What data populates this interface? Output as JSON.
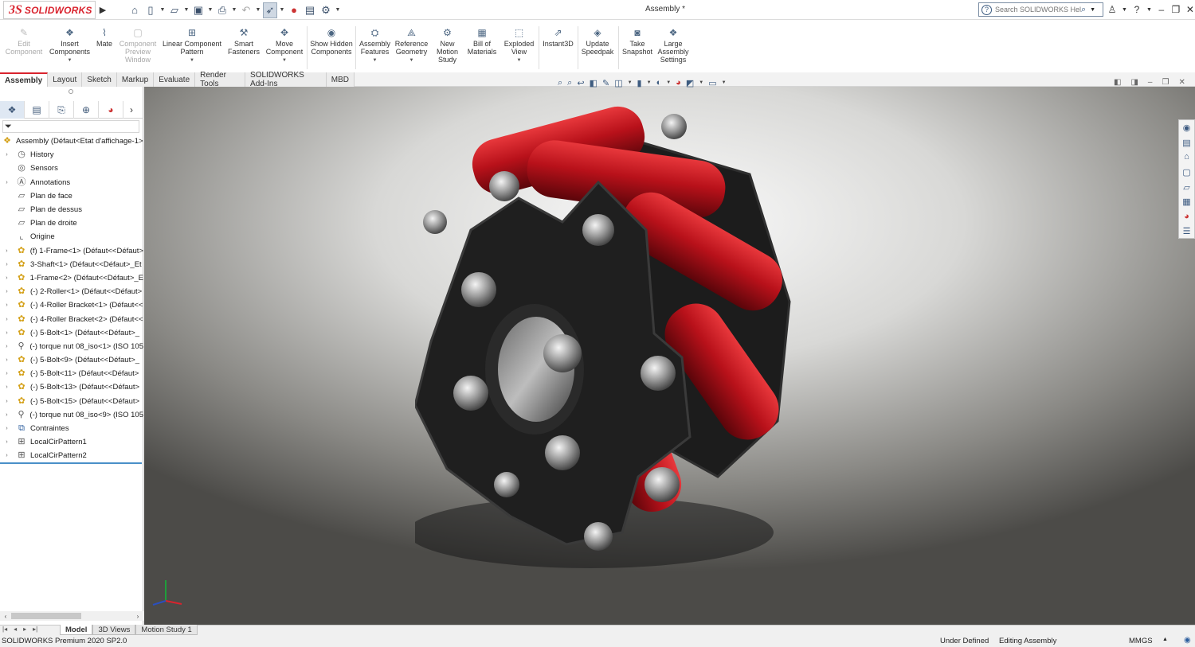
{
  "titlebar": {
    "brand": "SOLIDWORKS",
    "brand_mark": "3S",
    "document_title": "Assembly *",
    "help_search_placeholder": "Search SOLIDWORKS Help",
    "quick_tools": [
      "home-icon",
      "new-document-icon",
      "open-folder-icon",
      "save-icon",
      "print-icon",
      "undo-icon",
      "select-pointer-icon",
      "rebuild-icon",
      "file-properties-icon",
      "options-gear-icon"
    ]
  },
  "commands": [
    {
      "label": "Edit Component",
      "enabled": false
    },
    {
      "label": "Insert Components",
      "enabled": true
    },
    {
      "label": "Mate",
      "enabled": true
    },
    {
      "label": "Component Preview Window",
      "enabled": false
    },
    {
      "label": "Linear Component Pattern",
      "enabled": true
    },
    {
      "label": "Smart Fasteners",
      "enabled": true
    },
    {
      "label": "Move Component",
      "enabled": true
    },
    {
      "label": "Show Hidden Components",
      "enabled": true
    },
    {
      "label": "Assembly Features",
      "enabled": true
    },
    {
      "label": "Reference Geometry",
      "enabled": true
    },
    {
      "label": "New Motion Study",
      "enabled": true
    },
    {
      "label": "Bill of Materials",
      "enabled": true
    },
    {
      "label": "Exploded View",
      "enabled": true
    },
    {
      "label": "Instant3D",
      "enabled": true
    },
    {
      "label": "Update Speedpak",
      "enabled": true
    },
    {
      "label": "Take Snapshot",
      "enabled": true
    },
    {
      "label": "Large Assembly Settings",
      "enabled": true
    }
  ],
  "ribbon_tabs": [
    "Assembly",
    "Layout",
    "Sketch",
    "Markup",
    "Evaluate",
    "Render Tools",
    "SOLIDWORKS Add-Ins",
    "MBD"
  ],
  "active_ribbon_tab": "Assembly",
  "feature_tree": {
    "root": "Assembly  (Défaut<Etat d'affichage-1>",
    "items": [
      {
        "label": "History",
        "icon": "history-icon",
        "expandable": true
      },
      {
        "label": "Sensors",
        "icon": "sensors-icon",
        "expandable": false
      },
      {
        "label": "Annotations",
        "icon": "annotations-icon",
        "expandable": true
      },
      {
        "label": "Plan de face",
        "icon": "plane-icon",
        "expandable": false
      },
      {
        "label": "Plan de dessus",
        "icon": "plane-icon",
        "expandable": false
      },
      {
        "label": "Plan de droite",
        "icon": "plane-icon",
        "expandable": false
      },
      {
        "label": "Origine",
        "icon": "origin-icon",
        "expandable": false
      },
      {
        "label": "(f) 1-Frame<1> (Défaut<<Défaut>",
        "icon": "part-icon",
        "expandable": true
      },
      {
        "label": "3-Shaft<1> (Défaut<<Défaut>_Et",
        "icon": "part-icon",
        "expandable": true
      },
      {
        "label": "1-Frame<2> (Défaut<<Défaut>_E",
        "icon": "part-icon",
        "expandable": true
      },
      {
        "label": "(-) 2-Roller<1> (Défaut<<Défaut>",
        "icon": "part-icon",
        "expandable": true
      },
      {
        "label": "(-) 4-Roller Bracket<1> (Défaut<<",
        "icon": "part-icon",
        "expandable": true
      },
      {
        "label": "(-) 4-Roller Bracket<2> (Défaut<<",
        "icon": "part-icon",
        "expandable": true
      },
      {
        "label": "(-) 5-Bolt<1> (Défaut<<Défaut>_",
        "icon": "part-icon",
        "expandable": true
      },
      {
        "label": "(-) torque nut 08_iso<1> (ISO 105",
        "icon": "toolbox-icon",
        "expandable": true
      },
      {
        "label": "(-) 5-Bolt<9> (Défaut<<Défaut>_",
        "icon": "part-icon",
        "expandable": true
      },
      {
        "label": "(-) 5-Bolt<11> (Défaut<<Défaut>",
        "icon": "part-icon",
        "expandable": true
      },
      {
        "label": "(-) 5-Bolt<13> (Défaut<<Défaut>",
        "icon": "part-icon",
        "expandable": true
      },
      {
        "label": "(-) 5-Bolt<15> (Défaut<<Défaut>",
        "icon": "part-icon",
        "expandable": true
      },
      {
        "label": "(-) torque nut 08_iso<9> (ISO 105",
        "icon": "toolbox-icon",
        "expandable": true
      },
      {
        "label": "Contraintes",
        "icon": "mates-icon",
        "expandable": true
      },
      {
        "label": "LocalCirPattern1",
        "icon": "pattern-icon",
        "expandable": true
      },
      {
        "label": "LocalCirPattern2",
        "icon": "pattern-icon",
        "expandable": true
      }
    ]
  },
  "bottom_tabs": [
    "Model",
    "3D Views",
    "Motion Study 1"
  ],
  "active_bottom_tab": "Model",
  "status": {
    "product": "SOLIDWORKS Premium 2020 SP2.0",
    "definition": "Under Defined",
    "mode": "Editing Assembly",
    "units": "MMGS"
  },
  "colors": {
    "brand_red": "#d9232e",
    "roller_red": "#c0141c",
    "frame_black": "#1e1e1e",
    "tree_selection_line": "#4a90c8"
  }
}
